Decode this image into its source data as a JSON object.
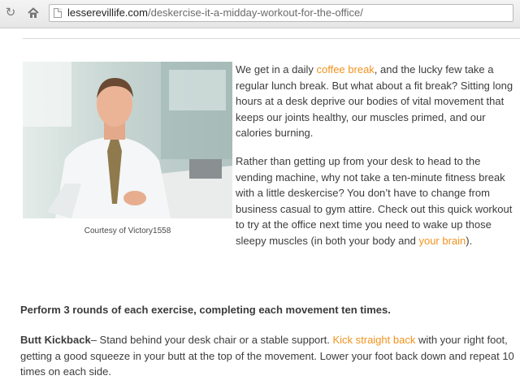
{
  "browser": {
    "url_host": "lesserevillife.com",
    "url_path": "/deskercise-it-a-midday-workout-for-the-office/"
  },
  "colors": {
    "link": "#f0931e",
    "text": "#3c3c3c"
  },
  "image": {
    "caption": "Courtesy of Victory1558"
  },
  "intro": {
    "p1": {
      "pre": "We get in a daily ",
      "link": "coffee break",
      "post": ", and the lucky few take a regular lunch break. But what about a fit break? Sitting long hours at a desk deprive our bodies of vital movement that keeps our joints healthy, our muscles primed, and our calories burning."
    },
    "p2": {
      "pre": "Rather than getting up from your desk to head to the vending machine, why not take a ten-minute fitness break with a little deskercise? You don’t have to change from business casual to gym attire. Check out this quick workout to try at the office next time you need to wake up those sleepy muscles (in both your body and ",
      "link": "your brain",
      "post": ")."
    }
  },
  "instructions": "Perform 3 rounds of each exercise, completing each movement ten times.",
  "exercise": {
    "name": "Butt Kickback",
    "pre": "– Stand behind your desk chair or a stable support. ",
    "link": "Kick straight back",
    "post": " with your right foot, getting a good squeeze in your butt at the top of the movement. Lower your foot back down and repeat 10 times on each side."
  }
}
